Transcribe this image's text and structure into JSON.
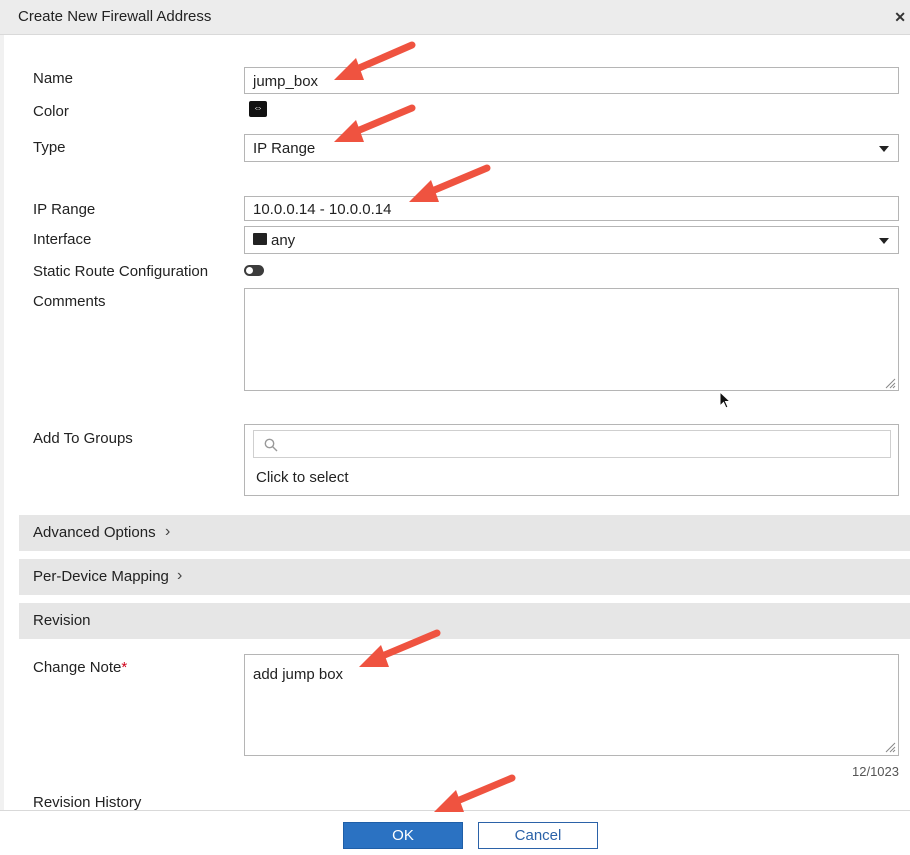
{
  "dialog": {
    "title": "Create New Firewall Address",
    "close_icon": "close-icon"
  },
  "form": {
    "name": {
      "label": "Name",
      "value": "jump_box"
    },
    "color": {
      "label": "Color",
      "icon": "color-swatch-icon"
    },
    "type": {
      "label": "Type",
      "value": "IP Range"
    },
    "ip_range": {
      "label": "IP Range",
      "value": "10.0.0.14 - 10.0.0.14"
    },
    "interface": {
      "label": "Interface",
      "value": "any",
      "icon": "interface-icon"
    },
    "static_route": {
      "label": "Static Route Configuration",
      "enabled": false
    },
    "comments": {
      "label": "Comments",
      "value": ""
    },
    "add_to_groups": {
      "label": "Add To Groups",
      "search_placeholder": "",
      "hint": "Click to select"
    }
  },
  "sections": {
    "advanced": {
      "label": "Advanced Options"
    },
    "per_device": {
      "label": "Per-Device Mapping"
    },
    "revision": {
      "label": "Revision"
    }
  },
  "revision": {
    "change_note": {
      "label": "Change Note",
      "required_mark": "*",
      "value": "add jump box",
      "counter": "12/1023"
    },
    "history": {
      "label": "Revision History"
    }
  },
  "footer": {
    "ok_label": "OK",
    "cancel_label": "Cancel"
  },
  "colors": {
    "annotation_arrow": "#ef5340",
    "primary_button": "#2b72c2",
    "section_bg": "#e6e6e6"
  }
}
